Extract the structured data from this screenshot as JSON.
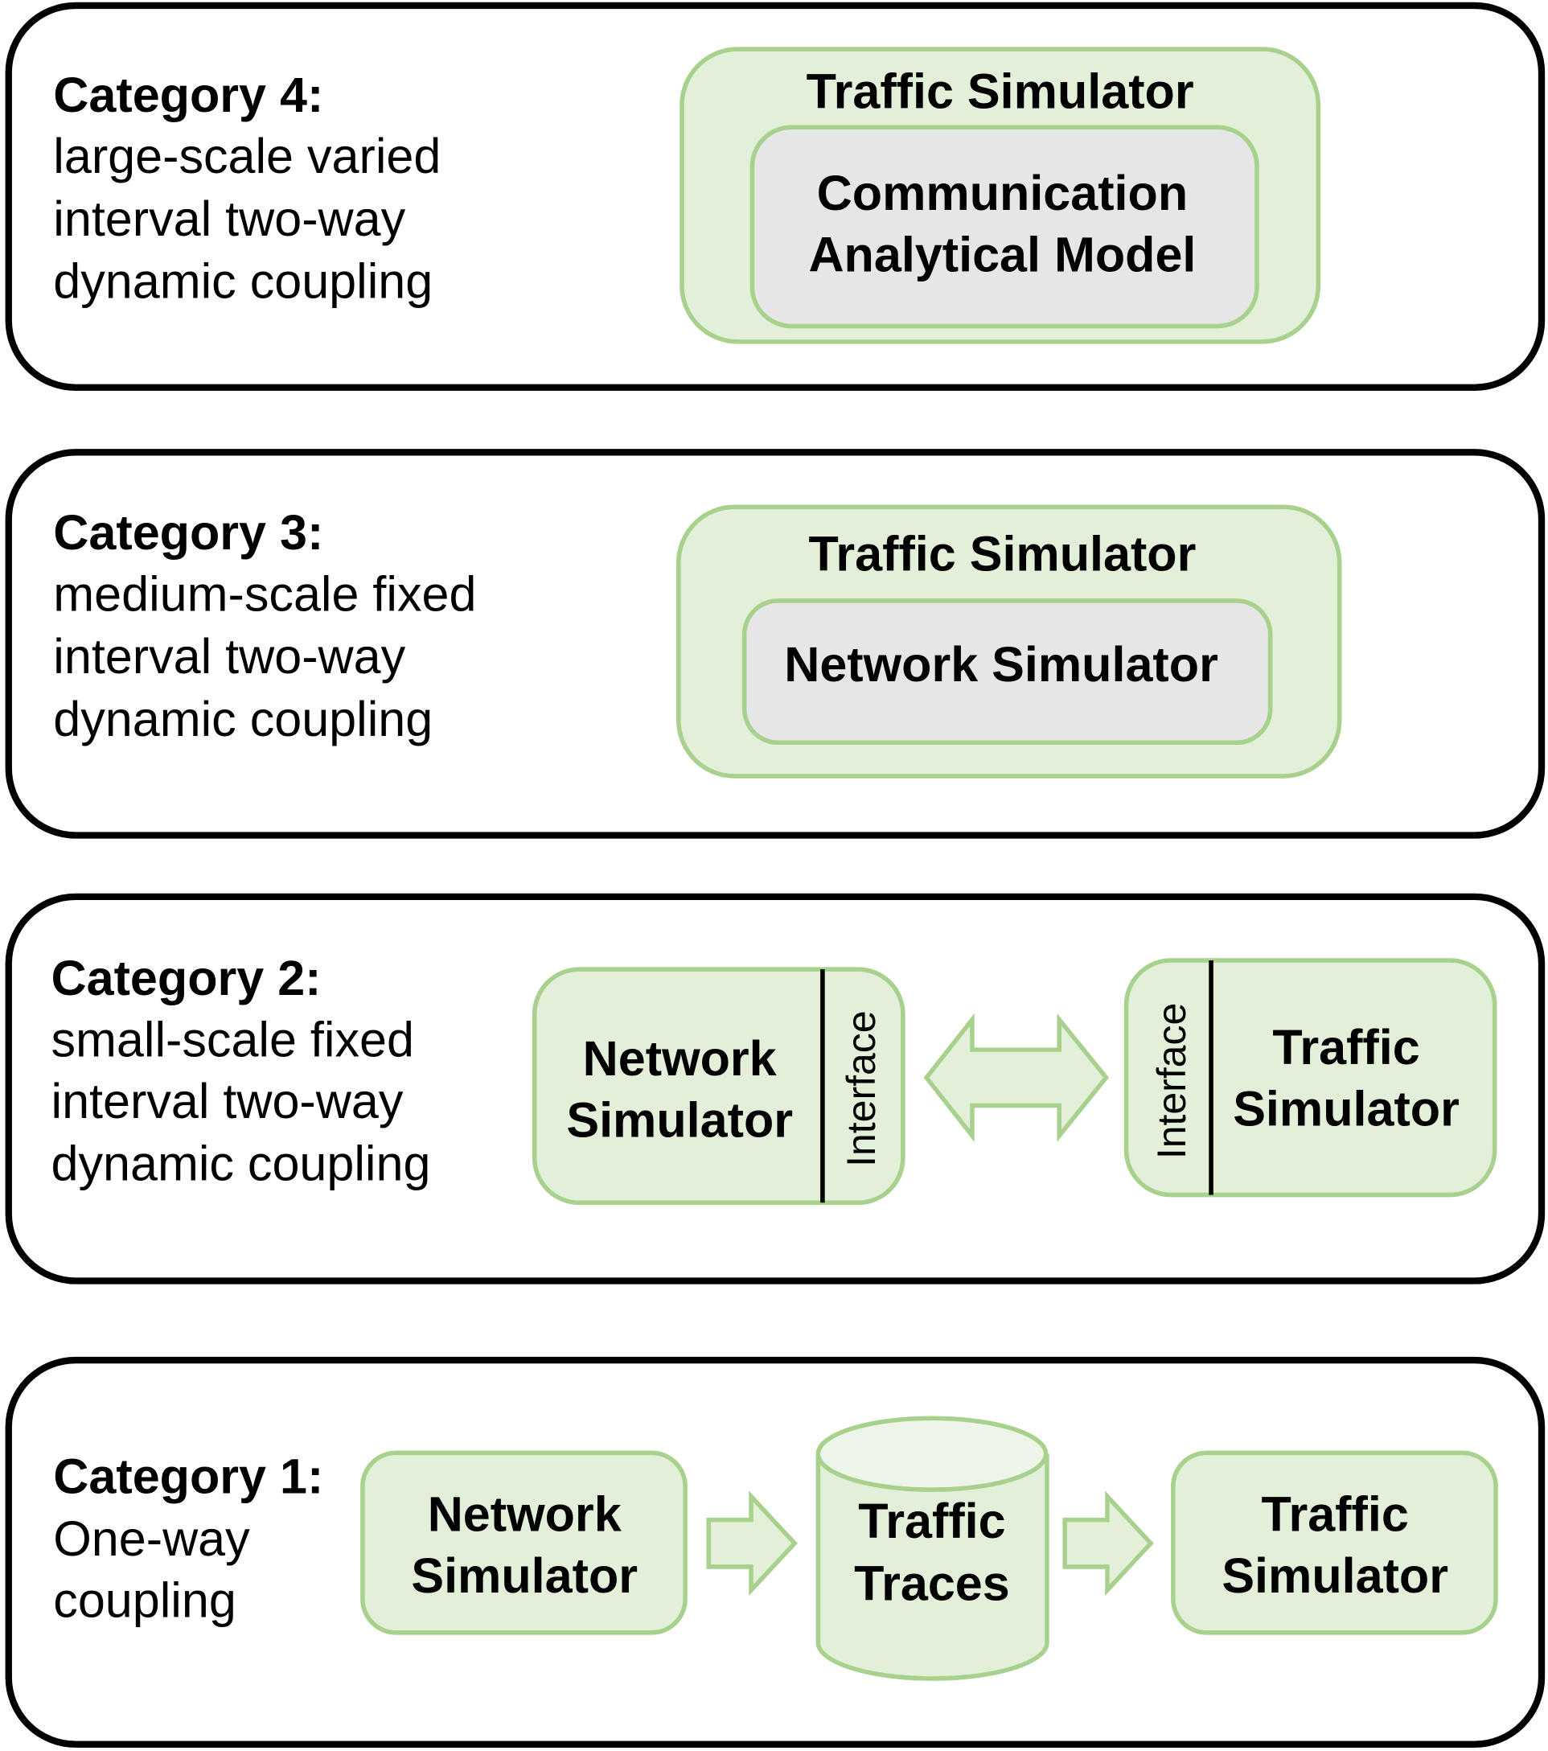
{
  "colors": {
    "green_fill": "#e2efd9",
    "green_stroke": "#a9d18e",
    "gray_fill": "#e6e6e6",
    "panel_stroke": "#000000"
  },
  "categories": [
    {
      "heading": "Category 4:",
      "lines": [
        "large-scale varied",
        "interval two-way",
        "dynamic coupling"
      ],
      "outer": "Traffic Simulator",
      "inner": [
        "Communication",
        "Analytical Model"
      ]
    },
    {
      "heading": "Category 3:",
      "lines": [
        "medium-scale fixed",
        "interval two-way",
        "dynamic coupling"
      ],
      "outer": "Traffic Simulator",
      "inner": [
        "Network Simulator"
      ]
    },
    {
      "heading": "Category 2:",
      "lines": [
        "small-scale fixed",
        "interval two-way",
        "dynamic coupling"
      ],
      "left": [
        "Network",
        "Simulator"
      ],
      "left_interface": "Interface",
      "right": [
        "Traffic",
        "Simulator"
      ],
      "right_interface": "Interface",
      "connector_icon": "double-arrow-icon"
    },
    {
      "heading": "Category 1:",
      "lines": [
        "One-way",
        "coupling"
      ],
      "source": [
        "Network",
        "Simulator"
      ],
      "store": [
        "Traffic",
        "Traces"
      ],
      "target": [
        "Traffic",
        "Simulator"
      ],
      "connector_icon": "right-arrow-icon"
    }
  ]
}
